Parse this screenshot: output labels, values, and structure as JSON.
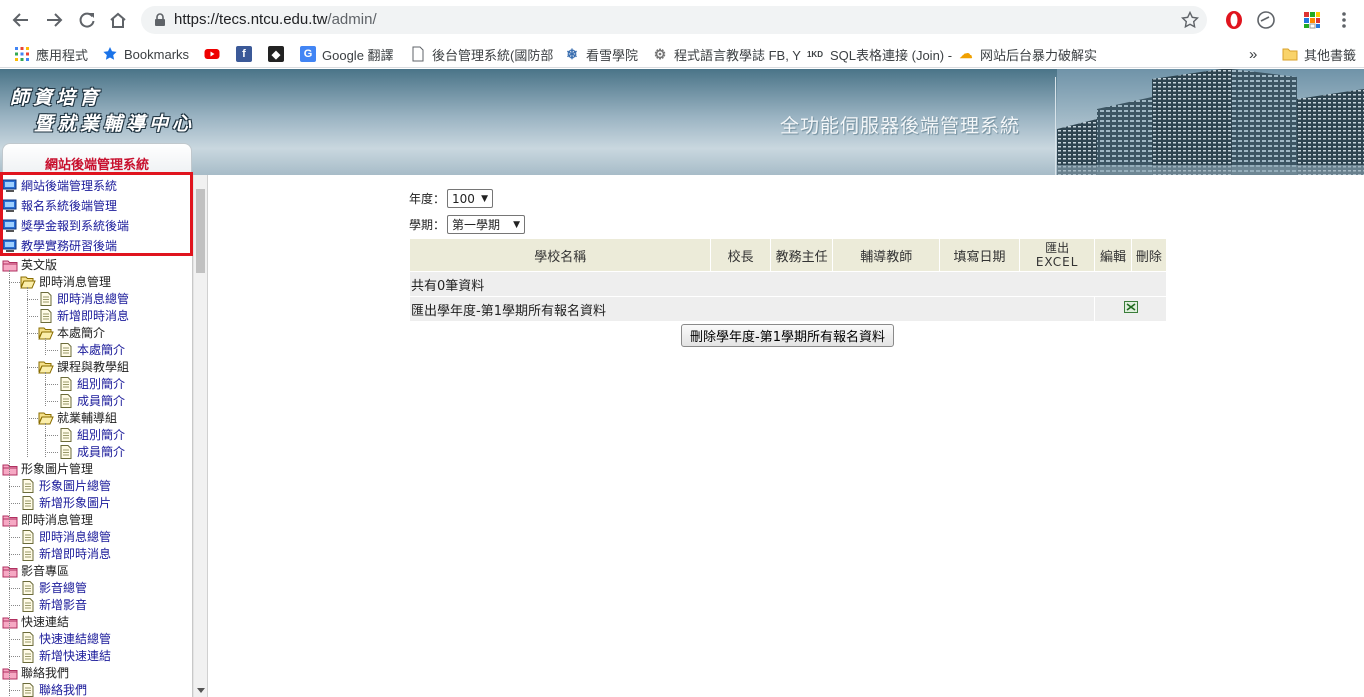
{
  "browser": {
    "url_host": "https://tecs.ntcu.edu.tw",
    "url_path": "/admin/",
    "bookmarks": [
      {
        "label": "應用程式",
        "icon": "apps-grid-icon"
      },
      {
        "label": "Bookmarks",
        "icon": "star-icon"
      },
      {
        "label": "",
        "icon": "youtube-icon"
      },
      {
        "label": "",
        "icon": "facebook-icon"
      },
      {
        "label": "",
        "icon": "codepen-icon"
      },
      {
        "label": "Google 翻譯",
        "icon": "google-translate-icon"
      },
      {
        "label": "後台管理系統(國防部",
        "icon": "page-icon"
      },
      {
        "label": "看雪學院",
        "icon": "snowflake-icon"
      },
      {
        "label": "程式語言教學誌 FB, Y",
        "icon": "gear-icon"
      },
      {
        "label": "SQL表格連接 (Join) -",
        "icon": "1kd-icon"
      },
      {
        "label": "网站后台暴力破解实",
        "icon": "cloud-icon"
      }
    ],
    "overflow_label": "»",
    "other_bookmarks": "其他書籤"
  },
  "header": {
    "logo_line1": "師資培育",
    "logo_line2": "暨就業輔導中心",
    "system_title": "全功能伺服器後端管理系統",
    "sidebar_tab": "網站後端管理系統"
  },
  "sidebar": {
    "top_links": [
      "網站後端管理系統",
      "報名系統後端管理",
      "獎學金報到系統後端",
      "教學實務研習後端"
    ],
    "tree": [
      {
        "label": "英文版",
        "level": 0,
        "type": "folder-pink"
      },
      {
        "label": "即時消息管理",
        "level": 1,
        "type": "folder-open"
      },
      {
        "label": "即時消息總管",
        "level": 2,
        "type": "page"
      },
      {
        "label": "新增即時消息",
        "level": 2,
        "type": "page"
      },
      {
        "label": "本處簡介",
        "level": 2,
        "type": "folder-open"
      },
      {
        "label": "本處簡介",
        "level": 3,
        "type": "page"
      },
      {
        "label": "課程與教學組",
        "level": 2,
        "type": "folder-open"
      },
      {
        "label": "組別簡介",
        "level": 3,
        "type": "page"
      },
      {
        "label": "成員簡介",
        "level": 3,
        "type": "page"
      },
      {
        "label": "就業輔導組",
        "level": 2,
        "type": "folder-open"
      },
      {
        "label": "組別簡介",
        "level": 3,
        "type": "page"
      },
      {
        "label": "成員簡介",
        "level": 3,
        "type": "page"
      },
      {
        "label": "形象圖片管理",
        "level": 0,
        "type": "folder-pink"
      },
      {
        "label": "形象圖片總管",
        "level": 1,
        "type": "page"
      },
      {
        "label": "新增形象圖片",
        "level": 1,
        "type": "page"
      },
      {
        "label": "即時消息管理",
        "level": 0,
        "type": "folder-pink"
      },
      {
        "label": "即時消息總管",
        "level": 1,
        "type": "page"
      },
      {
        "label": "新增即時消息",
        "level": 1,
        "type": "page"
      },
      {
        "label": "影音專區",
        "level": 0,
        "type": "folder-pink"
      },
      {
        "label": "影音總管",
        "level": 1,
        "type": "page"
      },
      {
        "label": "新增影音",
        "level": 1,
        "type": "page"
      },
      {
        "label": "快速連結",
        "level": 0,
        "type": "folder-pink"
      },
      {
        "label": "快速連結總管",
        "level": 1,
        "type": "page"
      },
      {
        "label": "新增快速連結",
        "level": 1,
        "type": "page"
      },
      {
        "label": "聯絡我們",
        "level": 0,
        "type": "folder-pink"
      },
      {
        "label": "聯絡我們",
        "level": 1,
        "type": "page"
      }
    ]
  },
  "main": {
    "year_label": "年度：",
    "year_value": "100",
    "term_label": "學期：",
    "term_value": "第一學期",
    "table": {
      "headers": [
        "學校名稱",
        "校長",
        "教務主任",
        "輔導教師",
        "填寫日期",
        "匯出EXCEL",
        "編輯",
        "刪除"
      ],
      "header_excel_line1": "匯出",
      "header_excel_line2": "EXCEL",
      "count_text": "共有0筆資料",
      "export_text": "匯出學年度-第1學期所有報名資料",
      "export_icon": "excel-icon"
    },
    "delete_button": "刪除學年度-第1學期所有報名資料"
  }
}
